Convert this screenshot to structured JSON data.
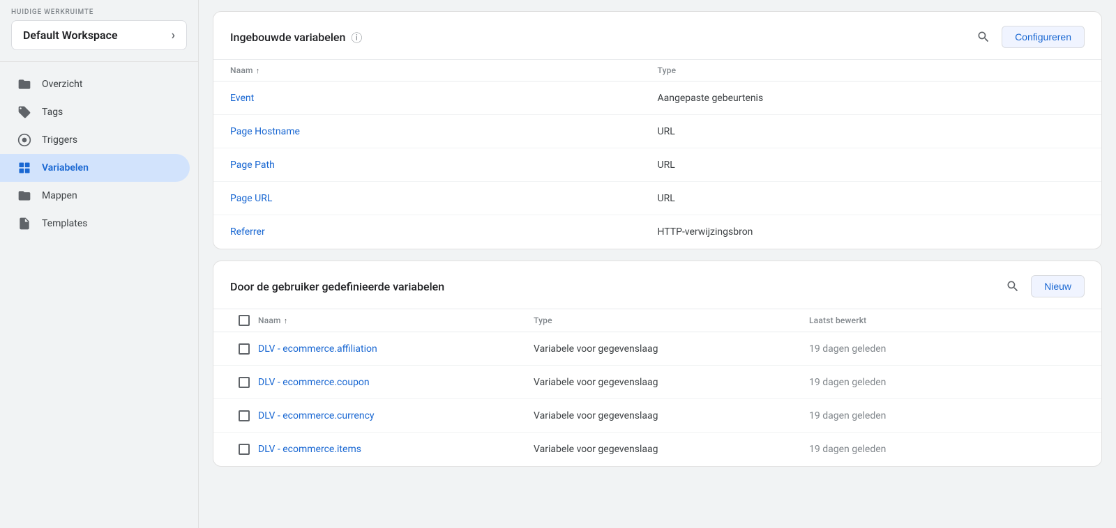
{
  "sidebar": {
    "workspace_label": "HUIDIGE WERKRUIMTE",
    "workspace_name": "Default Workspace",
    "chevron": "›",
    "nav_items": [
      {
        "id": "overzicht",
        "label": "Overzicht",
        "icon": "folder",
        "active": false
      },
      {
        "id": "tags",
        "label": "Tags",
        "icon": "tag",
        "active": false
      },
      {
        "id": "triggers",
        "label": "Triggers",
        "icon": "trigger",
        "active": false
      },
      {
        "id": "variabelen",
        "label": "Variabelen",
        "icon": "var",
        "active": true
      },
      {
        "id": "mappen",
        "label": "Mappen",
        "icon": "folder2",
        "active": false
      },
      {
        "id": "templates",
        "label": "Templates",
        "icon": "template",
        "active": false
      }
    ]
  },
  "builtin_card": {
    "title": "Ingebouwde variabelen",
    "help_icon": "?",
    "configure_btn": "Configureren",
    "columns": [
      {
        "label": "Naam",
        "sort": "↑"
      },
      {
        "label": "Type",
        "sort": ""
      }
    ],
    "rows": [
      {
        "name": "Event",
        "type": "Aangepaste gebeurtenis"
      },
      {
        "name": "Page Hostname",
        "type": "URL"
      },
      {
        "name": "Page Path",
        "type": "URL"
      },
      {
        "name": "Page URL",
        "type": "URL"
      },
      {
        "name": "Referrer",
        "type": "HTTP-verwijzingsbron"
      }
    ]
  },
  "user_card": {
    "title": "Door de gebruiker gedefinieerde variabelen",
    "new_btn": "Nieuw",
    "columns": [
      {
        "label": "",
        "sort": ""
      },
      {
        "label": "Naam",
        "sort": "↑"
      },
      {
        "label": "Type",
        "sort": ""
      },
      {
        "label": "Laatst bewerkt",
        "sort": ""
      }
    ],
    "rows": [
      {
        "name": "DLV - ecommerce.affiliation",
        "type": "Variabele voor gegevenslaag",
        "edited": "19 dagen geleden"
      },
      {
        "name": "DLV - ecommerce.coupon",
        "type": "Variabele voor gegevenslaag",
        "edited": "19 dagen geleden"
      },
      {
        "name": "DLV - ecommerce.currency",
        "type": "Variabele voor gegevenslaag",
        "edited": "19 dagen geleden"
      },
      {
        "name": "DLV - ecommerce.items",
        "type": "Variabele voor gegevenslaag",
        "edited": "19 dagen geleden"
      }
    ]
  }
}
